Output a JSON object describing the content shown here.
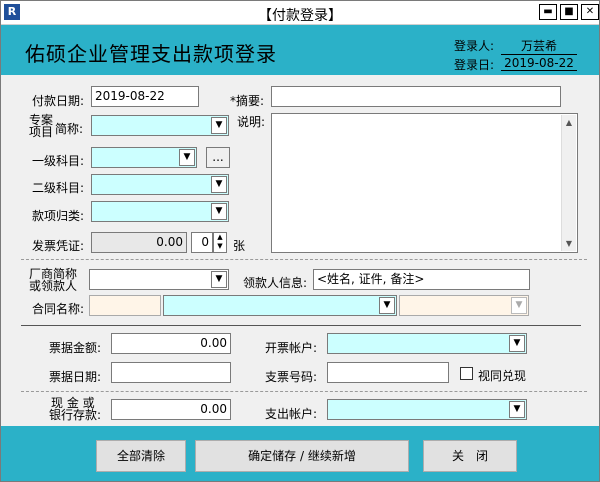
{
  "window": {
    "title": "【付款登录】"
  },
  "header": {
    "title": "佑硕企业管理支出款项登录",
    "login_user_label": "登录人:",
    "login_user_value": "万芸希",
    "login_date_label": "登录日:",
    "login_date_value": "2019-08-22"
  },
  "form": {
    "payment_date_label": "付款日期:",
    "payment_date_value": "2019-08-22",
    "summary_label": "*摘要:",
    "summary_value": "",
    "project_label_1": "专案",
    "project_label_2": "项目",
    "project_label_3": "简称:",
    "description_label": "说明:",
    "level1_label": "一级科目:",
    "level1_more": "...",
    "level2_label": "二级科目:",
    "category_label": "款项归类:",
    "invoice_label": "发票凭证:",
    "invoice_amount": "0.00",
    "invoice_count": "0",
    "invoice_unit": "张",
    "vendor_label_1": "厂商简称",
    "vendor_label_2": "或领款人",
    "recipient_label": "领款人信息:",
    "recipient_value": "<姓名, 证件, 备注>",
    "contract_label": "合同名称:",
    "bill_amount_label": "票据金额:",
    "bill_amount_value": "0.00",
    "invoice_account_label": "开票帐户:",
    "bill_date_label": "票据日期:",
    "cheque_no_label": "支票号码:",
    "treat_cashed_label": "视同兑现",
    "cash_label_1": "现 金 或",
    "cash_label_2": "银行存款:",
    "cash_value": "0.00",
    "pay_account_label": "支出帐户:"
  },
  "buttons": {
    "clear_all": "全部清除",
    "save_continue": "确定储存 / 继续新增",
    "close": "关　闭"
  }
}
